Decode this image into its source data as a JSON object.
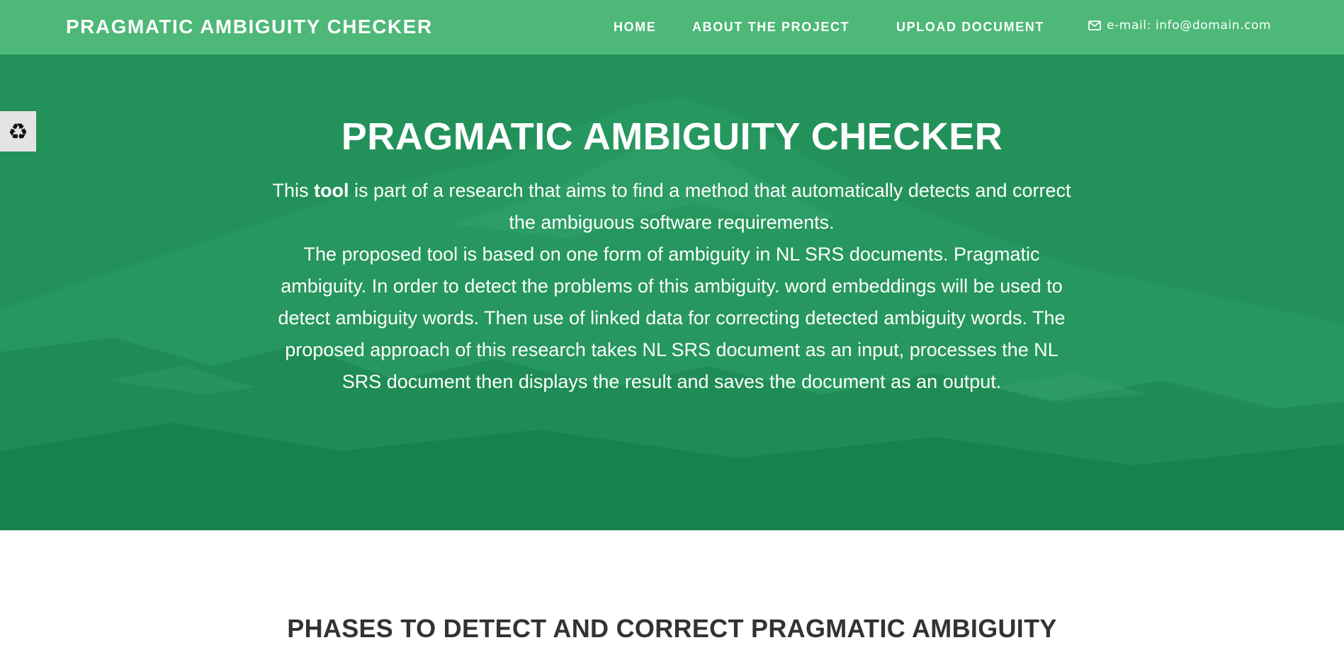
{
  "navbar": {
    "brand": "PRAGMATIC AMBIGUITY CHECKER",
    "links": [
      {
        "label": "HOME"
      },
      {
        "label": "ABOUT THE PROJECT"
      },
      {
        "label": "UPLOAD DOCUMENT"
      }
    ],
    "email": {
      "icon": "envelope-icon",
      "label": "e-mail: info@domain.com"
    }
  },
  "side_widget": {
    "icon": "recycle-icon",
    "glyph": "♻"
  },
  "hero": {
    "title": "PRAGMATIC AMBIGUITY CHECKER",
    "intro_prefix": "This ",
    "intro_bold": "tool",
    "intro_suffix": " is part of a research that aims to find a method that automatically detects and correct the ambiguous software requirements.",
    "body": "The proposed tool is based on one form of ambiguity in NL SRS documents. Pragmatic ambiguity. In order to detect the problems of this ambiguity. word embeddings will be used to detect ambiguity words. Then use of linked data for correcting detected ambiguity words. The proposed approach of this research takes NL SRS document as an input, processes the NL SRS document then displays the result and saves the document as an output."
  },
  "phases": {
    "title": "PHASES TO DETECT AND CORRECT PRAGMATIC AMBIGUITY"
  },
  "colors": {
    "navbar": "#4db877",
    "hero_overlay": "#23925a",
    "heading_dark": "#333333"
  }
}
